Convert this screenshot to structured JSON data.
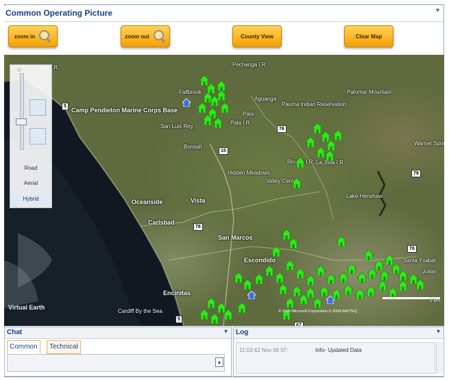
{
  "window": {
    "title": "Common Operating Picture",
    "collapse_icon": "chevron-down-icon"
  },
  "toolbar": {
    "zoom_in_label": "zoom in",
    "zoom_out_label": "zoom out",
    "county_view_label": "County View",
    "clear_map_label": "Clear Map",
    "accent_color": "#f5a100"
  },
  "map": {
    "view_options": [
      "Road",
      "Aerial",
      "Hybrid"
    ],
    "selected_view": "Hybrid",
    "places": [
      "Camp Pendleton Marine Corps Base",
      "Fallbrook",
      "Pala",
      "Pauma Indian Reservation",
      "Oceanside",
      "Vista",
      "Carlsbad",
      "San Marcos",
      "Escondido",
      "Encinitas",
      "Cardiff By the Sea",
      "Valley Center",
      "Lake Henshaw",
      "Pechanga I.R.",
      "Santa Ysabel",
      "Julian",
      "San Luis Rey",
      "Bonsall",
      "Hidden Meadows",
      "Rincon I.R.",
      "La Jolla I.R.",
      "Pala I.R.",
      "Aguanga",
      "Palomar Mountain",
      "Warner Springs"
    ],
    "scale_label": "5 km",
    "copyright": "© 2008 Microsoft Corporation  © 2008 NAVTEQ",
    "logo_text": "Virtual Earth",
    "marker_color": "#35e51e"
  },
  "chat": {
    "title": "Chat",
    "tabs": [
      "Common",
      "Technical"
    ],
    "selected_tab": "Common",
    "input_value": ""
  },
  "log": {
    "title": "Log",
    "entries": [
      {
        "time": "11:03:42 Nov 06 07:",
        "message": "Info- Updated Data"
      }
    ]
  }
}
